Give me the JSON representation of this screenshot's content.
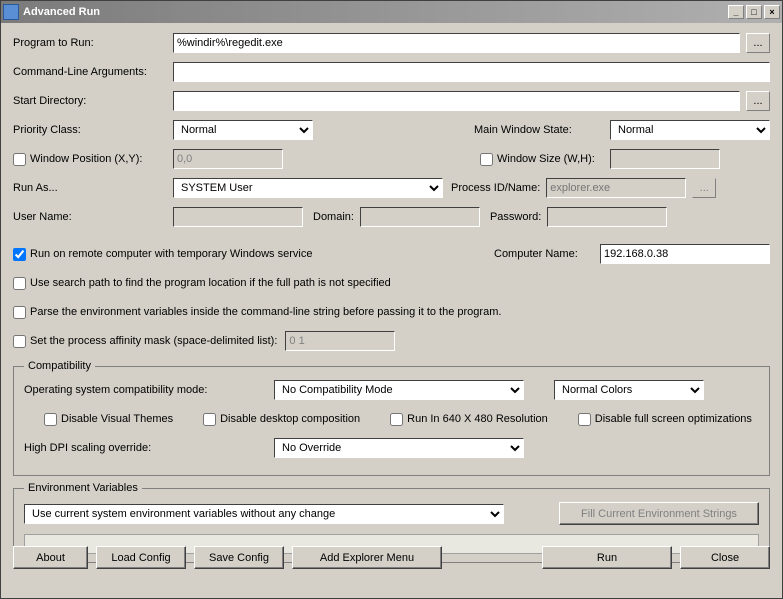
{
  "window": {
    "title": "Advanced Run"
  },
  "labels": {
    "program": "Program to Run:",
    "cmdline": "Command-Line Arguments:",
    "startdir": "Start Directory:",
    "priority": "Priority Class:",
    "mainwin": "Main Window State:",
    "winpos": "Window Position (X,Y):",
    "winsize": "Window Size (W,H):",
    "runas": "Run As...",
    "procid": "Process ID/Name:",
    "username": "User Name:",
    "domain": "Domain:",
    "password": "Password:",
    "remote": "Run on remote computer with temporary Windows service",
    "compname": "Computer Name:",
    "searchpath": "Use search path to find the program location if the full path is not specified",
    "parseenv": "Parse the environment variables inside the command-line string before passing it to the program.",
    "affinity": "Set the process affinity mask (space-delimited list):",
    "compat_legend": "Compatibility",
    "oscompat": "Operating system compatibility mode:",
    "disable_themes": "Disable Visual Themes",
    "disable_comp": "Disable desktop composition",
    "run640": "Run In 640 X 480 Resolution",
    "disable_fullscreen": "Disable full screen optimizations",
    "highdpi": "High DPI scaling override:",
    "env_legend": "Environment Variables",
    "fill_env": "Fill Current Environment Strings"
  },
  "values": {
    "program": "%windir%\\regedit.exe",
    "cmdline": "",
    "startdir": "",
    "priority": "Normal",
    "mainwin": "Normal",
    "winpos": "0,0",
    "winsize": "",
    "runas": "SYSTEM User",
    "procid_placeholder": "explorer.exe",
    "compname": "192.168.0.38",
    "affinity": "0 1",
    "oscompat": "No Compatibility Mode",
    "colors": "Normal Colors",
    "highdpi": "No Override",
    "envmode": "Use current system environment variables without any change"
  },
  "checks": {
    "winpos": false,
    "winsize": false,
    "remote": true,
    "searchpath": false,
    "parseenv": false,
    "affinity": false,
    "disable_themes": false,
    "disable_comp": false,
    "run640": false,
    "disable_fullscreen": false
  },
  "buttons": {
    "about": "About",
    "load": "Load Config",
    "save": "Save Config",
    "addmenu": "Add Explorer Menu",
    "run": "Run",
    "close": "Close"
  }
}
